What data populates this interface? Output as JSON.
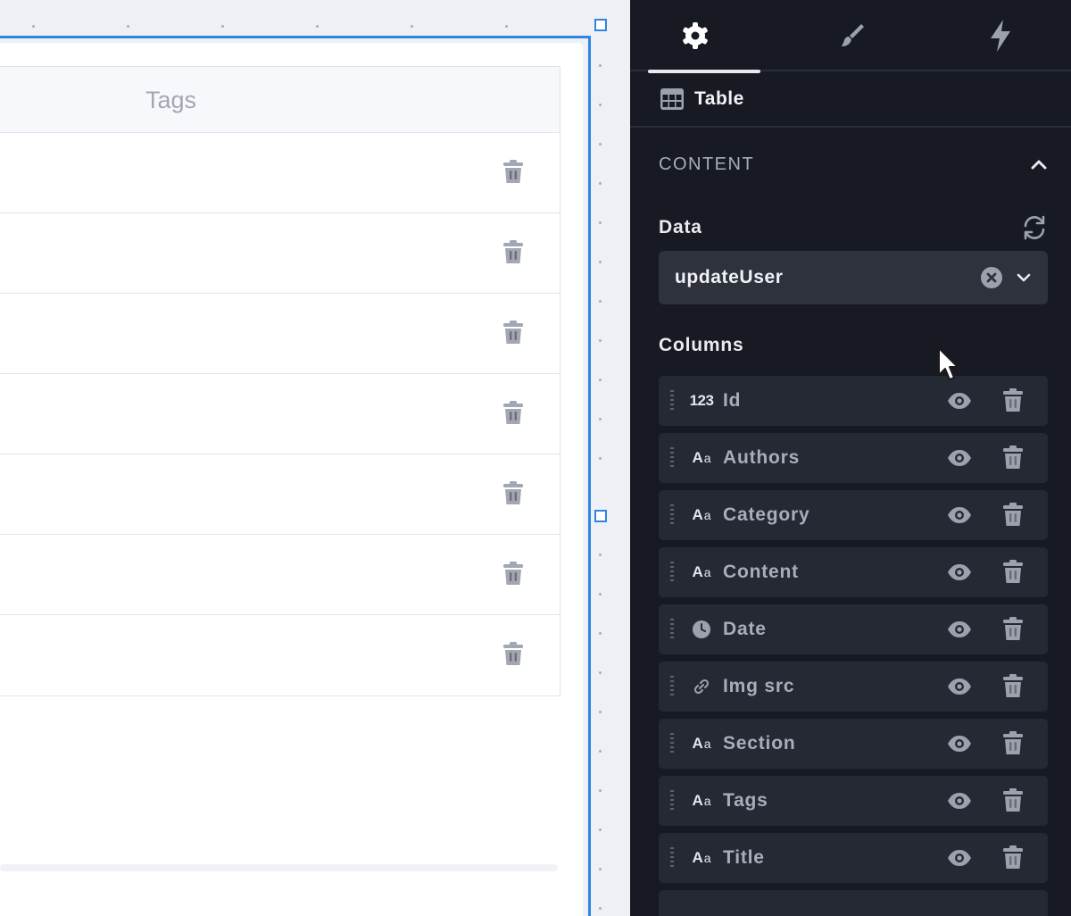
{
  "canvas": {
    "table": {
      "header": {
        "column_label": "Tags"
      },
      "row_count": 7
    }
  },
  "panel": {
    "tabs": [
      {
        "icon": "gear-icon",
        "active": true
      },
      {
        "icon": "brush-icon",
        "active": false
      },
      {
        "icon": "lightning-icon",
        "active": false
      }
    ],
    "component": {
      "icon": "table-icon",
      "title": "Table"
    },
    "content_section": {
      "label": "CONTENT",
      "expanded": true
    },
    "data": {
      "label": "Data",
      "selected_value": "updateUser"
    },
    "columns": {
      "label": "Columns",
      "items": [
        {
          "type": "number",
          "type_glyph": "123",
          "name": "Id"
        },
        {
          "type": "text",
          "type_glyph": "Aa",
          "name": "Authors"
        },
        {
          "type": "text",
          "type_glyph": "Aa",
          "name": "Category"
        },
        {
          "type": "text",
          "type_glyph": "Aa",
          "name": "Content"
        },
        {
          "type": "date",
          "type_glyph": "clock",
          "name": "Date"
        },
        {
          "type": "link",
          "type_glyph": "link",
          "name": "Img src"
        },
        {
          "type": "text",
          "type_glyph": "Aa",
          "name": "Section"
        },
        {
          "type": "text",
          "type_glyph": "Aa",
          "name": "Tags"
        },
        {
          "type": "text",
          "type_glyph": "Aa",
          "name": "Title"
        }
      ]
    }
  },
  "colors": {
    "selection": "#2f86e0",
    "panel_bg": "#171a22",
    "column_item_bg": "#252934",
    "select_bg": "#2e323d"
  }
}
